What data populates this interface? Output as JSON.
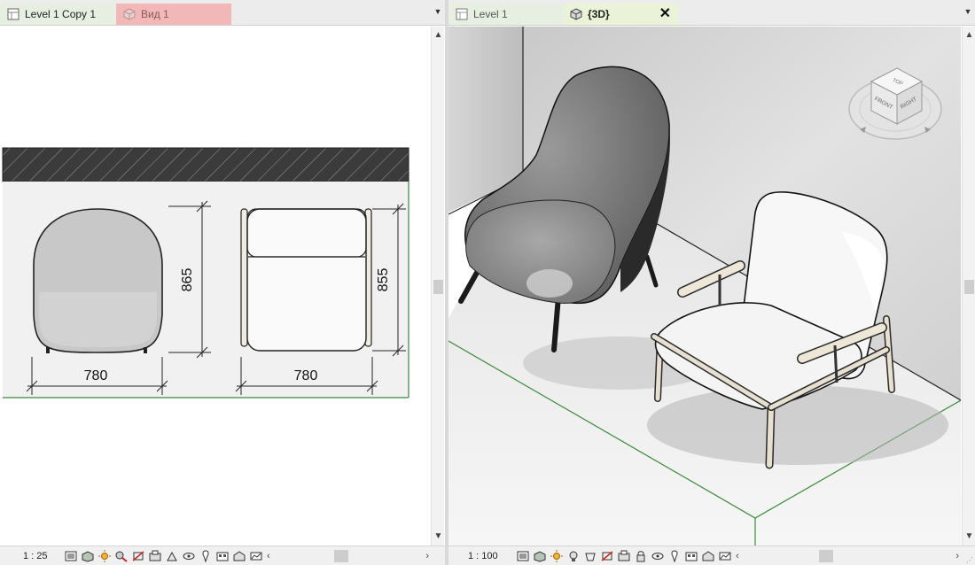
{
  "left_view": {
    "tabs": [
      {
        "label": "Level 1 Copy 1",
        "active": true,
        "color": "#e6efe2"
      },
      {
        "label": "Вид 1",
        "active": false,
        "color": "#f2b8b8"
      }
    ],
    "scale": "1 : 25",
    "drawing": {
      "dimensions": [
        "865",
        "855",
        "780",
        "780"
      ]
    }
  },
  "right_view": {
    "tabs": [
      {
        "label": "Level 1",
        "active": false,
        "color": "#e6efe2"
      },
      {
        "label": "{3D}",
        "active": true,
        "color": "#eaf3d8"
      }
    ],
    "close_glyph": "✕",
    "scale": "1 : 100",
    "viewcube": {
      "faces": [
        "TOP",
        "FRONT",
        "RIGHT"
      ]
    }
  },
  "colors": {
    "level_line": "#3a8a3a",
    "wall_hatch": "#3b3b3b"
  },
  "icons": [
    "view-tab-icon",
    "3d-view-icon",
    "detail-level-icon",
    "visual-style-icon",
    "sun-path-icon",
    "shadows-icon",
    "crop-view-icon",
    "temporary-hide-icon",
    "reveal-hidden-icon",
    "worksharing-icon",
    "analytical-model-icon"
  ]
}
